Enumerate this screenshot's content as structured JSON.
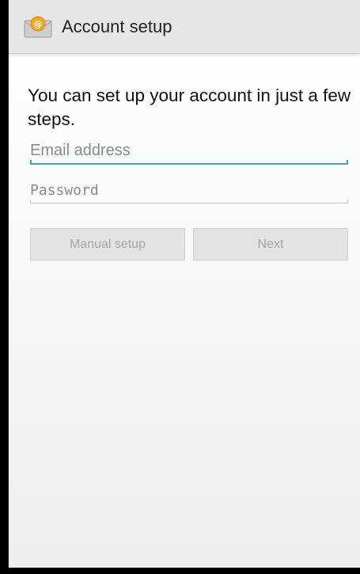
{
  "header": {
    "title": "Account setup",
    "icon": "email-app-icon"
  },
  "intro_text": "You can set up your account in just a few steps.",
  "form": {
    "email": {
      "value": "",
      "placeholder": "Email address"
    },
    "password": {
      "value": "",
      "placeholder": "Password"
    }
  },
  "buttons": {
    "manual_setup": "Manual setup",
    "next": "Next"
  },
  "colors": {
    "accent": "#33a7d8",
    "action_bar": "#e6e6e6",
    "disabled_text": "#a6a6a6"
  }
}
